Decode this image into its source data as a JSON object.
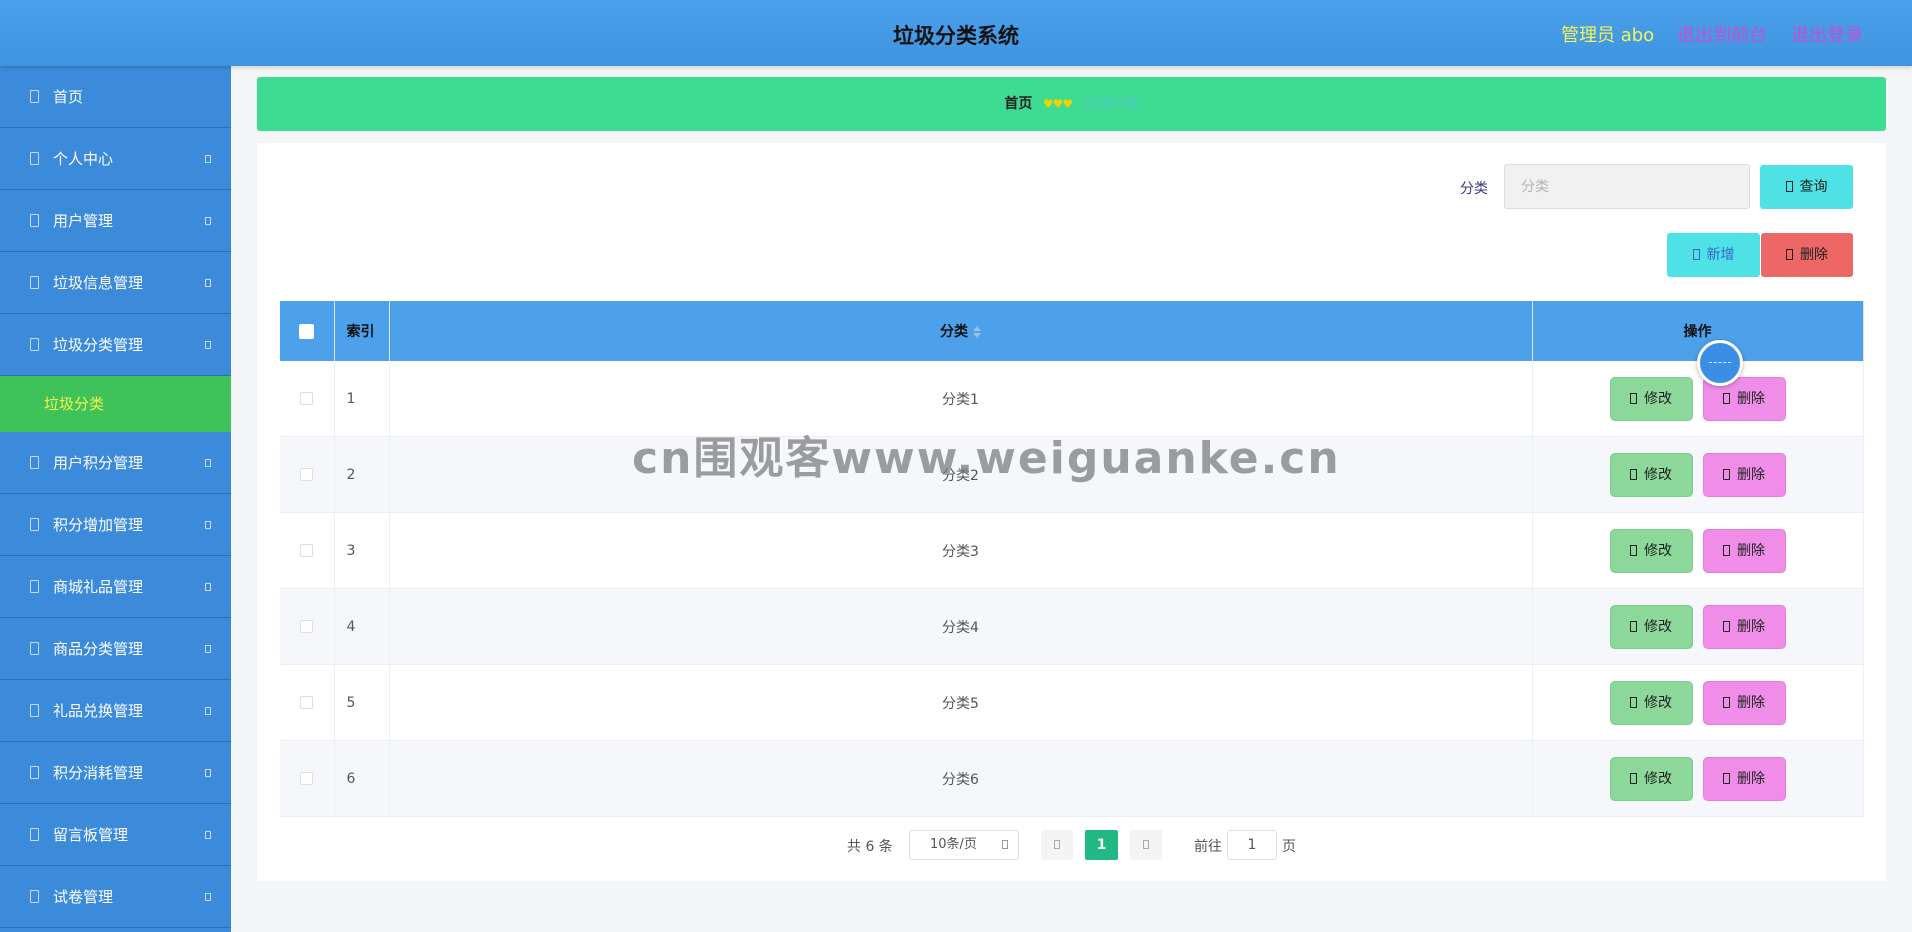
{
  "header": {
    "title": "垃圾分类系统",
    "admin": "管理员 abo",
    "back_to_front": "退出到前台",
    "logout": "退出登录"
  },
  "sidebar": {
    "items": [
      {
        "label": "首页",
        "has_arrow": false
      },
      {
        "label": "个人中心",
        "has_arrow": true
      },
      {
        "label": "用户管理",
        "has_arrow": true
      },
      {
        "label": "垃圾信息管理",
        "has_arrow": true
      },
      {
        "label": "垃圾分类管理",
        "has_arrow": true
      },
      {
        "label": "用户积分管理",
        "has_arrow": true
      },
      {
        "label": "积分增加管理",
        "has_arrow": true
      },
      {
        "label": "商城礼品管理",
        "has_arrow": true
      },
      {
        "label": "商品分类管理",
        "has_arrow": true
      },
      {
        "label": "礼品兑换管理",
        "has_arrow": true
      },
      {
        "label": "积分消耗管理",
        "has_arrow": true
      },
      {
        "label": "留言板管理",
        "has_arrow": true
      },
      {
        "label": "试卷管理",
        "has_arrow": true
      }
    ],
    "active_sub": "垃圾分类"
  },
  "breadcrumb": {
    "home": "首页",
    "separator": "♥♥♥",
    "current": "垃圾分类"
  },
  "search": {
    "label": "分类",
    "placeholder": "分类",
    "query_button": "查询"
  },
  "actions": {
    "add_button": "新增",
    "delete_button": "删除"
  },
  "table": {
    "headers": {
      "index": "索引",
      "category": "分类",
      "operations": "操作"
    },
    "rows": [
      {
        "index": "1",
        "category": "分类1"
      },
      {
        "index": "2",
        "category": "分类2"
      },
      {
        "index": "3",
        "category": "分类3"
      },
      {
        "index": "4",
        "category": "分类4"
      },
      {
        "index": "5",
        "category": "分类5"
      },
      {
        "index": "6",
        "category": "分类6"
      }
    ],
    "edit_label": "修改",
    "delete_label": "删除"
  },
  "pagination": {
    "total": "共 6 条",
    "page_size": "10条/页",
    "current_page": "1",
    "goto_label": "前往",
    "goto_value": "1",
    "page_suffix": "页"
  },
  "watermark": "cn围观客www.weiguanke.cn",
  "colors": {
    "header_bg": "#4aa0ea",
    "sidebar_bg": "#3c8bdb",
    "sidebar_active": "#3fc25a",
    "breadcrumb_bg": "#3edb93",
    "table_header_bg": "#4da0ea",
    "edit_button": "#8bd89a",
    "delete_button": "#ef8de9",
    "query_button": "#4ee2e6",
    "bulk_delete": "#ed6767",
    "page_active": "#22b883"
  }
}
